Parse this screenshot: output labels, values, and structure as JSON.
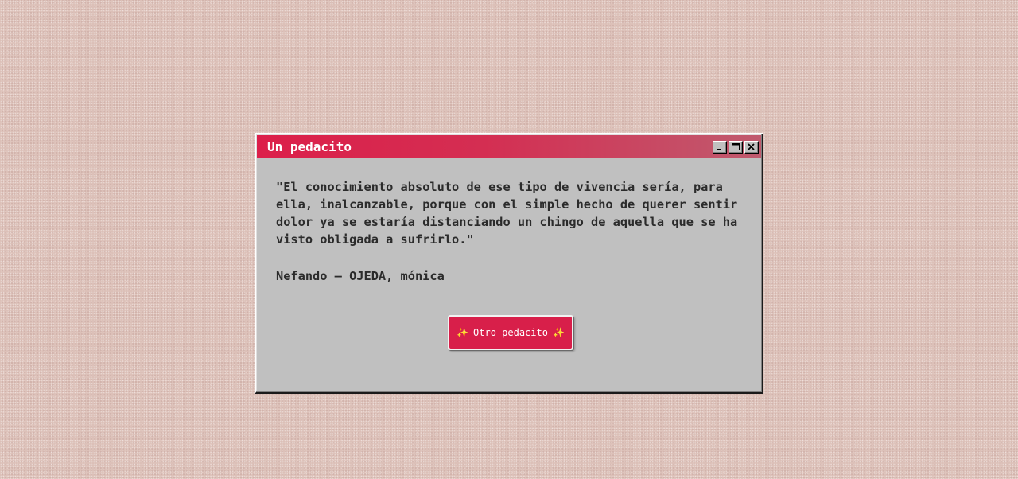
{
  "window": {
    "title": "Un pedacito",
    "controls": {
      "minimize_icon": "minimize-icon",
      "maximize_icon": "maximize-icon",
      "close_icon": "close-icon"
    }
  },
  "quote": {
    "text": "\"El conocimiento absoluto de ese tipo de vivencia sería, para ella, inalcanzable, porque con el simple hecho de querer sentir dolor ya se estaría distanciando un chingo de aquella que se ha visto obligada a sufrirlo.\"",
    "attribution": "Nefando — OJEDA, mónica"
  },
  "button": {
    "label": "Otro pedacito",
    "sparkle": "✨",
    "icon": "sparkles-icon"
  },
  "colors": {
    "titlebar_start": "#dc1f4a",
    "titlebar_end": "#c05a6e",
    "button_bg": "#d81f4a",
    "window_bg": "#c0c0c0",
    "desktop_bg": "#dcc0b8"
  }
}
